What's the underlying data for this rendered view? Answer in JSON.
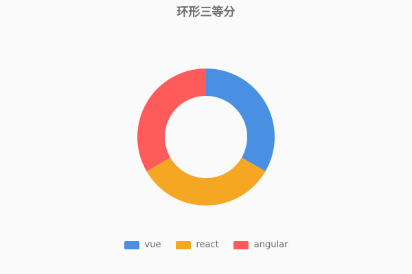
{
  "chart_data": {
    "type": "pie",
    "title": "环形三等分",
    "categories": [
      "vue",
      "react",
      "angular"
    ],
    "values": [
      1,
      1,
      1
    ],
    "colors": [
      "#4a90e2",
      "#f5a623",
      "#ff5b5b"
    ],
    "inner_radius_ratio": 0.6,
    "legend_position": "bottom"
  },
  "legend": {
    "items": [
      {
        "label": "vue",
        "color": "#4a90e2"
      },
      {
        "label": "react",
        "color": "#f5a623"
      },
      {
        "label": "angular",
        "color": "#ff5b5b"
      }
    ]
  }
}
